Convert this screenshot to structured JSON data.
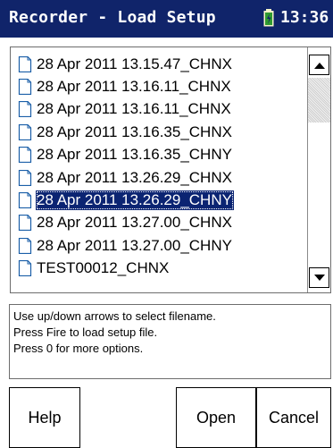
{
  "window": {
    "title": "Recorder - Load Setup",
    "time": "13:36"
  },
  "icons": {
    "battery": "battery-icon",
    "file": "file-icon",
    "scroll_up": "up-arrow-icon",
    "scroll_down": "down-arrow-icon"
  },
  "colors": {
    "titlebar": "#10246a",
    "selection": "#0b2472"
  },
  "file_list": {
    "items": [
      {
        "label": "28 Apr 2011 13.15.47_CHNX",
        "selected": false
      },
      {
        "label": "28 Apr 2011 13.16.11_CHNX",
        "selected": false
      },
      {
        "label": "28 Apr 2011 13.16.11_CHNX",
        "selected": false
      },
      {
        "label": "28 Apr 2011 13.16.35_CHNX",
        "selected": false
      },
      {
        "label": "28 Apr 2011 13.16.35_CHNY",
        "selected": false
      },
      {
        "label": "28 Apr 2011 13.26.29_CHNX",
        "selected": false
      },
      {
        "label": "28 Apr 2011 13.26.29_CHNY",
        "selected": true
      },
      {
        "label": "28 Apr 2011 13.27.00_CHNX",
        "selected": false
      },
      {
        "label": "28 Apr 2011 13.27.00_CHNY",
        "selected": false
      },
      {
        "label": "TEST00012_CHNX",
        "selected": false
      }
    ]
  },
  "help": {
    "lines": [
      "Use up/down arrows to select filename.",
      "Press Fire to load setup file.",
      "Press 0 for more options."
    ]
  },
  "buttons": {
    "help": "Help",
    "open": "Open",
    "cancel": "Cancel"
  }
}
